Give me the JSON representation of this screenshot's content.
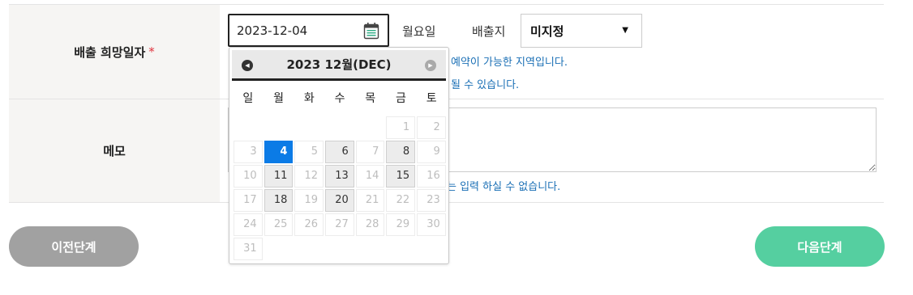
{
  "form": {
    "date_label": "배출 희망일자",
    "required_mark": "*",
    "date_value": "2023-12-04",
    "weekday_text": "월요일",
    "origin_label": "배출지",
    "origin_value": "미지정",
    "info_line1": "예약이 가능한 지역입니다.",
    "info_line2": "될 수 있습니다.",
    "memo_label": "메모",
    "memo_note": "는 입력 하실 수 없습니다."
  },
  "buttons": {
    "prev": "이전단계",
    "next": "다음단계"
  },
  "calendar": {
    "title": "2023 12월(DEC)",
    "weekdays": [
      "일",
      "월",
      "화",
      "수",
      "목",
      "금",
      "토"
    ],
    "cells": [
      {
        "d": ""
      },
      {
        "d": ""
      },
      {
        "d": ""
      },
      {
        "d": ""
      },
      {
        "d": ""
      },
      {
        "d": "1",
        "s": "dis"
      },
      {
        "d": "2",
        "s": "dis"
      },
      {
        "d": "3",
        "s": "dis"
      },
      {
        "d": "4",
        "s": "sel"
      },
      {
        "d": "5",
        "s": "dis"
      },
      {
        "d": "6",
        "s": "avail"
      },
      {
        "d": "7",
        "s": "dis"
      },
      {
        "d": "8",
        "s": "avail"
      },
      {
        "d": "9",
        "s": "dis"
      },
      {
        "d": "10",
        "s": "dis"
      },
      {
        "d": "11",
        "s": "avail"
      },
      {
        "d": "12",
        "s": "dis"
      },
      {
        "d": "13",
        "s": "avail"
      },
      {
        "d": "14",
        "s": "dis"
      },
      {
        "d": "15",
        "s": "avail"
      },
      {
        "d": "16",
        "s": "dis"
      },
      {
        "d": "17",
        "s": "dis"
      },
      {
        "d": "18",
        "s": "avail"
      },
      {
        "d": "19",
        "s": "dis"
      },
      {
        "d": "20",
        "s": "avail"
      },
      {
        "d": "21",
        "s": "dis"
      },
      {
        "d": "22",
        "s": "dis"
      },
      {
        "d": "23",
        "s": "dis"
      },
      {
        "d": "24",
        "s": "dis"
      },
      {
        "d": "25",
        "s": "dis"
      },
      {
        "d": "26",
        "s": "dis"
      },
      {
        "d": "27",
        "s": "dis"
      },
      {
        "d": "28",
        "s": "dis"
      },
      {
        "d": "29",
        "s": "dis"
      },
      {
        "d": "30",
        "s": "dis"
      },
      {
        "d": "31",
        "s": "dis"
      }
    ]
  },
  "icons": {
    "calendar": "calendar-icon",
    "prev": "chevron-left-icon",
    "next": "chevron-right-icon",
    "dropdown": "caret-down-icon"
  },
  "colors": {
    "selected": "#0b7be6",
    "next_button": "#55cfa0",
    "prev_button": "#a1a1a1",
    "info_text": "#1a6fb5",
    "required": "#e0323d"
  }
}
